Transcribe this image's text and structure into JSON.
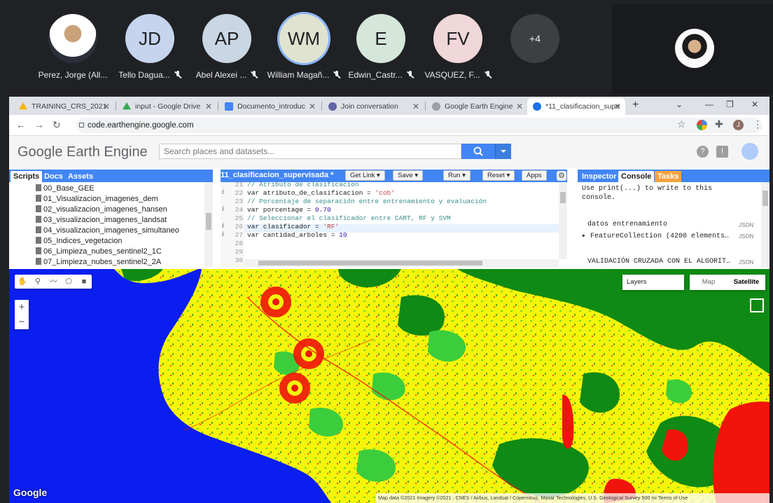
{
  "meeting": {
    "participants": [
      {
        "initials": "",
        "name": "Perez, Jorge (All...",
        "color": "",
        "muted": false,
        "photo": true
      },
      {
        "initials": "JD",
        "name": "Tello Dagua...",
        "color": "#c6d4ee",
        "muted": true
      },
      {
        "initials": "AP",
        "name": "Abel Alexei ...",
        "color": "#c9d6e3",
        "muted": true
      },
      {
        "initials": "WM",
        "name": "William Magañ...",
        "color": "#dfe3d0",
        "muted": true,
        "active": true
      },
      {
        "initials": "E",
        "name": "Edwin_Castr...",
        "color": "#d5e6da",
        "muted": true
      },
      {
        "initials": "FV",
        "name": "VASQUEZ, F...",
        "color": "#f0d7da",
        "muted": true
      }
    ],
    "more_count": "+4"
  },
  "browser": {
    "tabs": [
      {
        "title": "TRAINING_CRS_2021",
        "fav_color": "#f4b400"
      },
      {
        "title": "input - Google Drive",
        "fav_color": "#34a853"
      },
      {
        "title": "Documento_introduc",
        "fav_color": "#4285f4"
      },
      {
        "title": "Join conversation",
        "fav_color": "#6264a7"
      },
      {
        "title": "Google Earth Engine",
        "fav_color": "#9aa0a6"
      },
      {
        "title": "*11_clasificacion_supe",
        "fav_color": "#1a73e8"
      }
    ],
    "url": "code.earthengine.google.com",
    "profile_initial": "J"
  },
  "gee": {
    "logo": "Google Earth Engine",
    "search_placeholder": "Search places and datasets...",
    "left_tabs": [
      "Scripts",
      "Docs",
      "Assets"
    ],
    "files": [
      "00_Base_GEE",
      "01_Visualizacion_imagenes_dem",
      "02_visualizacion_imagenes_hansen",
      "03_visualizacion_imagenes_landsat",
      "04_visualizacion_imagenes_simultaneo",
      "05_Indices_vegetacion",
      "06_Limpieza_nubes_sentinel2_1C",
      "07_Limpieza_nubes_sentinel2_2A"
    ],
    "editor": {
      "title": "11_clasificacion_supervisada *",
      "buttons": {
        "get_link": "Get Link",
        "save": "Save",
        "run": "Run",
        "reset": "Reset",
        "apps": "Apps"
      },
      "lines": [
        {
          "n": "21",
          "info": false,
          "text": "// Atributo de clasificacion",
          "type": "cmt"
        },
        {
          "n": "22",
          "info": true,
          "text": "var atributo_de_clasificacion = ",
          "value": "'cob'",
          "vtype": "str"
        },
        {
          "n": "23",
          "info": false,
          "text": "// Porcentaje de separación entre entrenamiento y evaluación",
          "type": "cmt"
        },
        {
          "n": "24",
          "info": true,
          "text": "var porcentage = ",
          "value": "0.70",
          "vtype": "num"
        },
        {
          "n": "25",
          "info": false,
          "text": "// Seleccionar el clasificador entre CART, RF y SVM",
          "type": "cmt"
        },
        {
          "n": "26",
          "info": true,
          "text": "var clasificador = ",
          "value": "'RF'",
          "vtype": "str"
        },
        {
          "n": "27",
          "info": true,
          "text": "var cantidad_arboles = ",
          "value": "10",
          "vtype": "num"
        },
        {
          "n": "28",
          "info": false,
          "text": "",
          "type": ""
        },
        {
          "n": "29",
          "info": false,
          "text": "",
          "type": ""
        },
        {
          "n": "30",
          "info": false,
          "text": "",
          "type": ""
        }
      ]
    },
    "right_tabs": [
      "Inspector",
      "Console",
      "Tasks"
    ],
    "console": {
      "hint_1": "Use print(...) to write to this",
      "hint_2": "console.",
      "entries": [
        {
          "text": "datos entrenamiento",
          "tag": "JSON"
        },
        {
          "text": "▸ FeatureCollection (4200 elements…",
          "tag": "JSON"
        },
        {
          "text": "VALIDACIÓN CRUZADA CON EL ALGORIT…",
          "tag": "JSON"
        }
      ]
    },
    "map": {
      "layers_label": "Layers",
      "map_label": "Map",
      "satellite_label": "Satellite",
      "zoom_in": "+",
      "zoom_out": "−",
      "watermark": "Google",
      "attribution": "Map data ©2021 Imagery ©2021 , CNES / Airbus, Landsat / Copernicus, Maxar Technologies, U.S. Geological Survey   500 mi   Terms of Use",
      "colors": {
        "water": "#0a1ef0",
        "crop": "#f5f50a",
        "forest": "#0f8a14",
        "grass": "#3ccd3c",
        "urban": "#f0140a"
      }
    }
  }
}
